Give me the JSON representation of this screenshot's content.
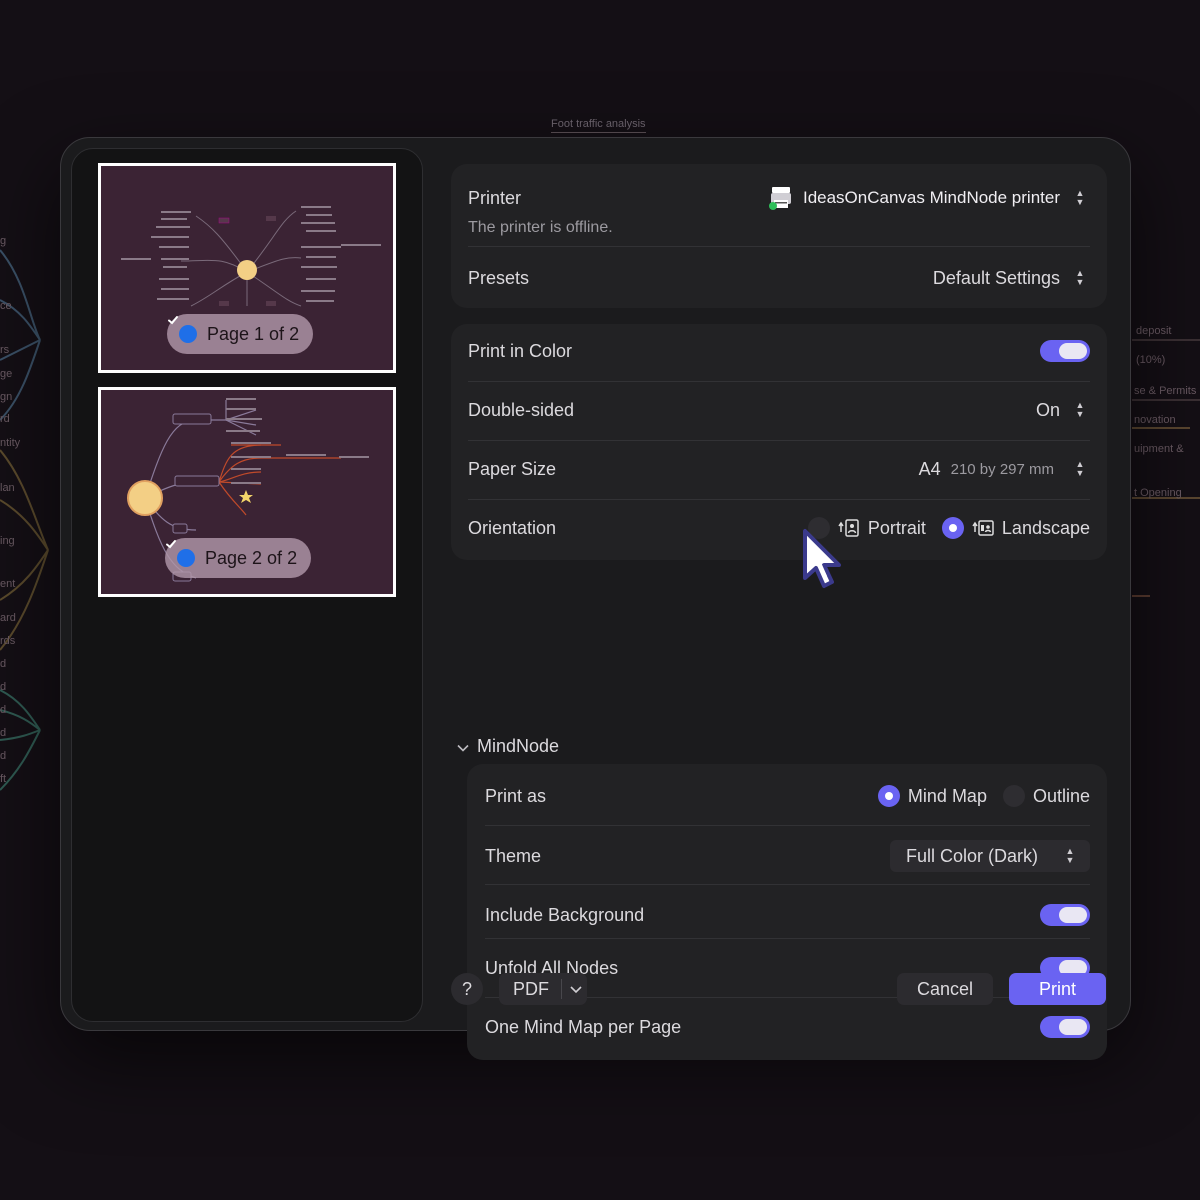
{
  "background": {
    "top_label": "Foot traffic analysis",
    "right_labels": [
      "deposit",
      "(10%)",
      "se & Permits",
      "novation",
      "uipment &",
      "t Opening"
    ],
    "left_labels": [
      "g",
      "ce",
      "rs",
      "ge",
      "gn",
      "rd",
      "ntity",
      "lan",
      "ing",
      "ent",
      "ard",
      "rds",
      "d",
      "d",
      "d",
      "d",
      "d",
      "ft"
    ]
  },
  "preview": {
    "pages": [
      {
        "label": "Page 1 of 2",
        "checked": true
      },
      {
        "label": "Page 2 of 2",
        "checked": true
      }
    ]
  },
  "printer_group": {
    "printer_label": "Printer",
    "printer_status": "The printer is offline.",
    "printer_name": "IdeasOnCanvas MindNode printer",
    "presets_label": "Presets",
    "presets_value": "Default Settings"
  },
  "options_group": {
    "color_label": "Print in Color",
    "color_on": true,
    "duplex_label": "Double-sided",
    "duplex_value": "On",
    "paper_label": "Paper Size",
    "paper_value": "A4",
    "paper_detail": "210 by 297 mm",
    "orientation_label": "Orientation",
    "orientation_portrait": "Portrait",
    "orientation_landscape": "Landscape",
    "orientation_selected": "Landscape"
  },
  "mindnode": {
    "section_title": "MindNode",
    "print_as_label": "Print as",
    "print_as_mindmap": "Mind Map",
    "print_as_outline": "Outline",
    "print_as_selected": "Mind Map",
    "theme_label": "Theme",
    "theme_value": "Full Color (Dark)",
    "background_label": "Include Background",
    "background_on": true,
    "unfold_label": "Unfold All Nodes",
    "unfold_on": true,
    "one_map_label": "One Mind Map per Page",
    "one_map_on": true
  },
  "footer": {
    "help_label": "?",
    "pdf_label": "PDF",
    "cancel_label": "Cancel",
    "print_label": "Print"
  },
  "colors": {
    "accent": "#6a63f2",
    "dialog_bg": "#1b1b1d",
    "group_bg": "#222224",
    "thumb_bg": "#3b2334",
    "pill_check": "#1f6fe8"
  }
}
